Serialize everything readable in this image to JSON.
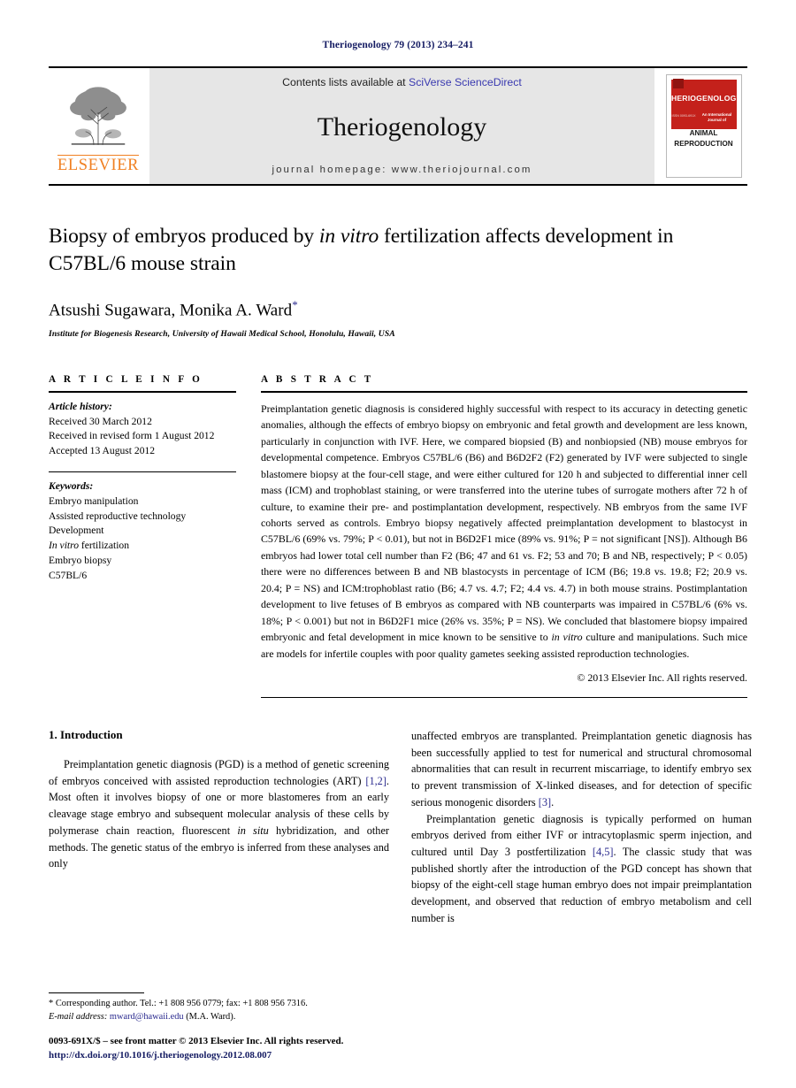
{
  "running_head": "Theriogenology 79 (2013) 234–241",
  "masthead": {
    "publisher_name": "ELSEVIER",
    "contents_prefix": "Contents lists available at ",
    "contents_link": "SciVerse ScienceDirect",
    "journal_name": "Theriogenology",
    "homepage": "journal homepage: www.theriojournal.com",
    "cover": {
      "title": "THERIOGENOLOGY",
      "sub_left": "ISSN 0093-691X",
      "sub_right": "An International Journal of",
      "animal_line1": "ANIMAL",
      "animal_line2": "REPRODUCTION"
    },
    "link_color": "#3a3ab0"
  },
  "article": {
    "title_line1_a": "Biopsy of embryos produced by ",
    "title_line1_it": "in vitro",
    "title_line1_b": " fertilization affects development",
    "title_line2": "in C57BL/6 mouse strain",
    "authors": "Atsushi Sugawara, Monika A. Ward",
    "author_marker": "*",
    "affiliation": "Institute for Biogenesis Research, University of Hawaii Medical School, Honolulu, Hawaii, USA"
  },
  "article_info": {
    "heading": "A R T I C L E   I N F O",
    "history_label": "Article history:",
    "history": [
      "Received 30 March 2012",
      "Received in revised form 1 August 2012",
      "Accepted 13 August 2012"
    ],
    "keywords_label": "Keywords:",
    "keywords": [
      "Embryo manipulation",
      "Assisted reproductive technology",
      "Development",
      "In vitro fertilization",
      "Embryo biopsy",
      "C57BL/6"
    ],
    "keyword_italic_index": 3,
    "keyword_italic_lead": "In vitro",
    "keyword_italic_rest": " fertilization"
  },
  "abstract": {
    "heading": "A B S T R A C T",
    "part1": "Preimplantation genetic diagnosis is considered highly successful with respect to its accuracy in detecting genetic anomalies, although the effects of embryo biopsy on embryonic and fetal growth and development are less known, particularly in conjunction with IVF. Here, we compared biopsied (B) and nonbiopsied (NB) mouse embryos for developmental competence. Embryos C57BL/6 (B6) and B6D2F2 (F2) generated by IVF were subjected to single blastomere biopsy at the four-cell stage, and were either cultured for 120 h and subjected to differential inner cell mass (ICM) and trophoblast staining, or were transferred into the uterine tubes of surrogate mothers after 72 h of culture, to examine their pre- and postimplantation development, respectively. NB embryos from the same IVF cohorts served as controls. Embryo biopsy negatively affected preimplantation development to blastocyst in C57BL/6 (69% vs. 79%; P < 0.01), but not in B6D2F1 mice (89% vs. 91%; P = not significant [NS]). Although B6 embryos had lower total cell number than F2 (B6; 47 and 61 vs. F2; 53 and 70; B and NB, respectively; P < 0.05) there were no differences between B and NB blastocysts in percentage of ICM (B6; 19.8 vs. 19.8; F2; 20.9 vs. 20.4; P = NS) and ICM:trophoblast ratio (B6; 4.7 vs. 4.7; F2; 4.4 vs. 4.7) in both mouse strains. Postimplantation development to live fetuses of B embryos as compared with NB counterparts was impaired in C57BL/6 (6% vs. 18%; P < 0.001) but not in B6D2F1 mice (26% vs. 35%; P = NS). We concluded that blastomere biopsy impaired embryonic and fetal development in mice known to be sensitive to ",
    "italic_phrase": "in vitro",
    "part2": " culture and manipulations. Such mice are models for infertile couples with poor quality gametes seeking assisted reproduction technologies.",
    "copyright": "© 2013 Elsevier Inc. All rights reserved."
  },
  "introduction": {
    "heading": "1. Introduction",
    "left_par1_a": "Preimplantation genetic diagnosis (PGD) is a method of genetic screening of embryos conceived with assisted reproduction technologies (ART) ",
    "left_par1_ref": "[1,2]",
    "left_par1_b": ". Most often it involves biopsy of one or more blastomeres from an early cleavage stage embryo and subsequent molecular analysis of these cells by polymerase chain reaction, fluorescent ",
    "left_par1_it": "in situ",
    "left_par1_c": " hybridization, and other methods. The genetic status of the embryo is inferred from these analyses and only",
    "right_par1_a": "unaffected embryos are transplanted. Preimplantation genetic diagnosis has been successfully applied to test for numerical and structural chromosomal abnormalities that can result in recurrent miscarriage, to identify embryo sex to prevent transmission of X-linked diseases, and for detection of specific serious monogenic disorders ",
    "right_par1_ref": "[3]",
    "right_par1_b": ".",
    "right_par2_a": "Preimplantation genetic diagnosis is typically performed on human embryos derived from either IVF or intracytoplasmic sperm injection, and cultured until Day 3 postfertilization ",
    "right_par2_ref": "[4,5]",
    "right_par2_b": ". The classic study that was published shortly after the introduction of the PGD concept has shown that biopsy of the eight-cell stage human embryo does not impair preimplantation development, and observed that reduction of embryo metabolism and cell number is"
  },
  "footnotes": {
    "corresponding_marker": "*",
    "corresponding_text": "Corresponding author. Tel.: +1 808 956 0779; fax: +1 808 956 7316.",
    "email_label": "E-mail address:",
    "email": "mward@hawaii.edu",
    "email_suffix": " (M.A. Ward).",
    "issn_line": "0093-691X/$ – see front matter © 2013 Elsevier Inc. All rights reserved.",
    "doi": "http://dx.doi.org/10.1016/j.theriogenology.2012.08.007"
  }
}
